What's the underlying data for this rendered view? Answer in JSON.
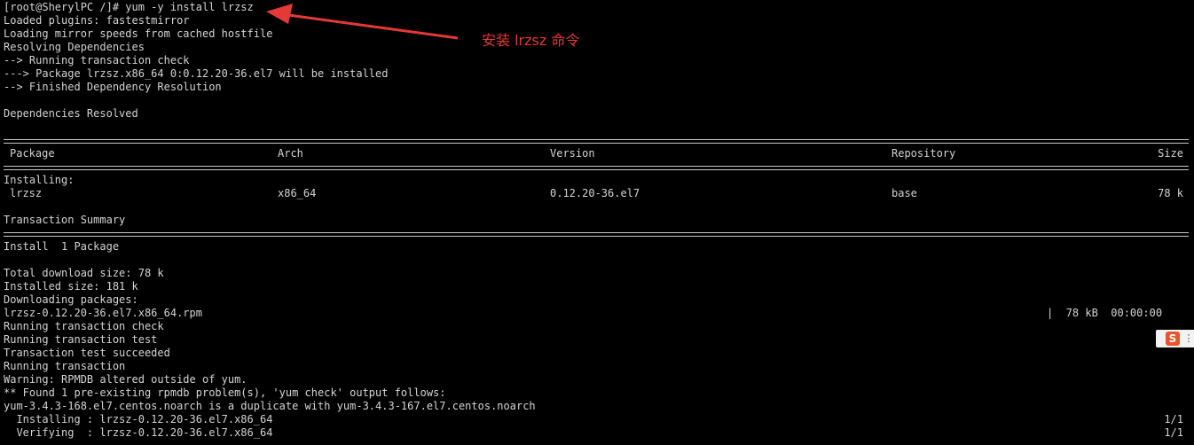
{
  "prompt": "[root@SherylPC /]# yum -y install lrzsz",
  "header_lines": [
    "Loaded plugins: fastestmirror",
    "Loading mirror speeds from cached hostfile",
    "Resolving Dependencies",
    "--> Running transaction check",
    "---> Package lrzsz.x86_64 0:0.12.20-36.el7 will be installed",
    "--> Finished Dependency Resolution",
    "",
    "Dependencies Resolved"
  ],
  "table": {
    "headers": {
      "package": "Package",
      "arch": "Arch",
      "version": "Version",
      "repository": "Repository",
      "size": "Size"
    },
    "section_label": "Installing:",
    "row": {
      "package": "lrzsz",
      "arch": "x86_64",
      "version": "0.12.20-36.el7",
      "repository": "base",
      "size": "78 k"
    }
  },
  "transaction_summary": "Transaction Summary",
  "install_summary": "Install  1 Package",
  "download_lines": [
    "Total download size: 78 k",
    "Installed size: 181 k",
    "Downloading packages:",
    "lrzsz-0.12.20-36.el7.x86_64.rpm"
  ],
  "download_progress": "|  78 kB  00:00:00",
  "transaction_lines": [
    "Running transaction check",
    "Running transaction test",
    "Transaction test succeeded",
    "Running transaction",
    "Warning: RPMDB altered outside of yum.",
    "** Found 1 pre-existing rpmdb problem(s), 'yum check' output follows:",
    "yum-3.4.3-168.el7.centos.noarch is a duplicate with yum-3.4.3-167.el7.centos.noarch"
  ],
  "steps": [
    {
      "text": "  Installing : lrzsz-0.12.20-36.el7.x86_64",
      "count": "1/1"
    },
    {
      "text": "  Verifying  : lrzsz-0.12.20-36.el7.x86_64",
      "count": "1/1"
    }
  ],
  "annotation": "安装 lrzsz 命令",
  "widget": {
    "logo_letter": "S",
    "more_glyph": "⋮",
    "icon": "sogou-ime-icon"
  },
  "colors": {
    "background": "#000000",
    "text": "#d4d4d4",
    "annotation": "#e53935",
    "widget_logo": "#e8542c"
  }
}
